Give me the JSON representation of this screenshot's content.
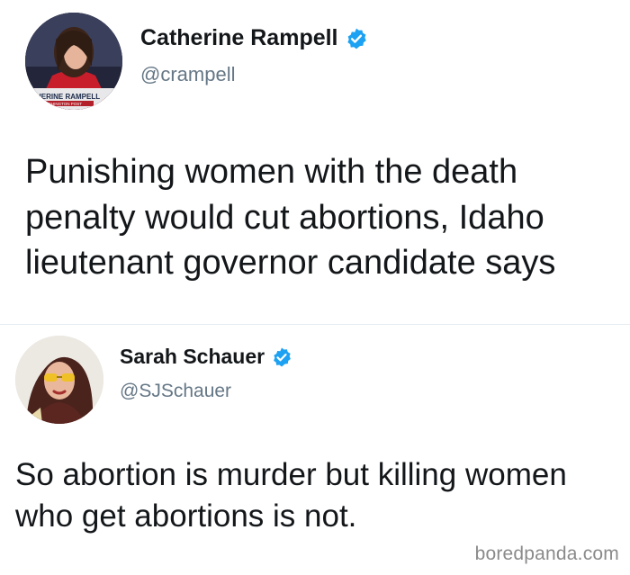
{
  "tweets": [
    {
      "display_name": "Catherine Rampell",
      "handle": "@crampell",
      "verified": true,
      "text": "Punishing women with the death penalty would cut abortions, Idaho lieutenant governor candidate says",
      "avatar_caption_name": "HERINE RAMPELL",
      "avatar_caption_org": "T, WASHINGTON POST"
    },
    {
      "display_name": "Sarah Schauer",
      "handle": "@SJSchauer",
      "verified": true,
      "text": "So abortion is murder but killing women who get abortions is not."
    }
  ],
  "watermark": "boredpanda.com",
  "colors": {
    "verified_blue": "#1da1f2",
    "handle_gray": "#657786",
    "text_dark": "#14171a"
  }
}
